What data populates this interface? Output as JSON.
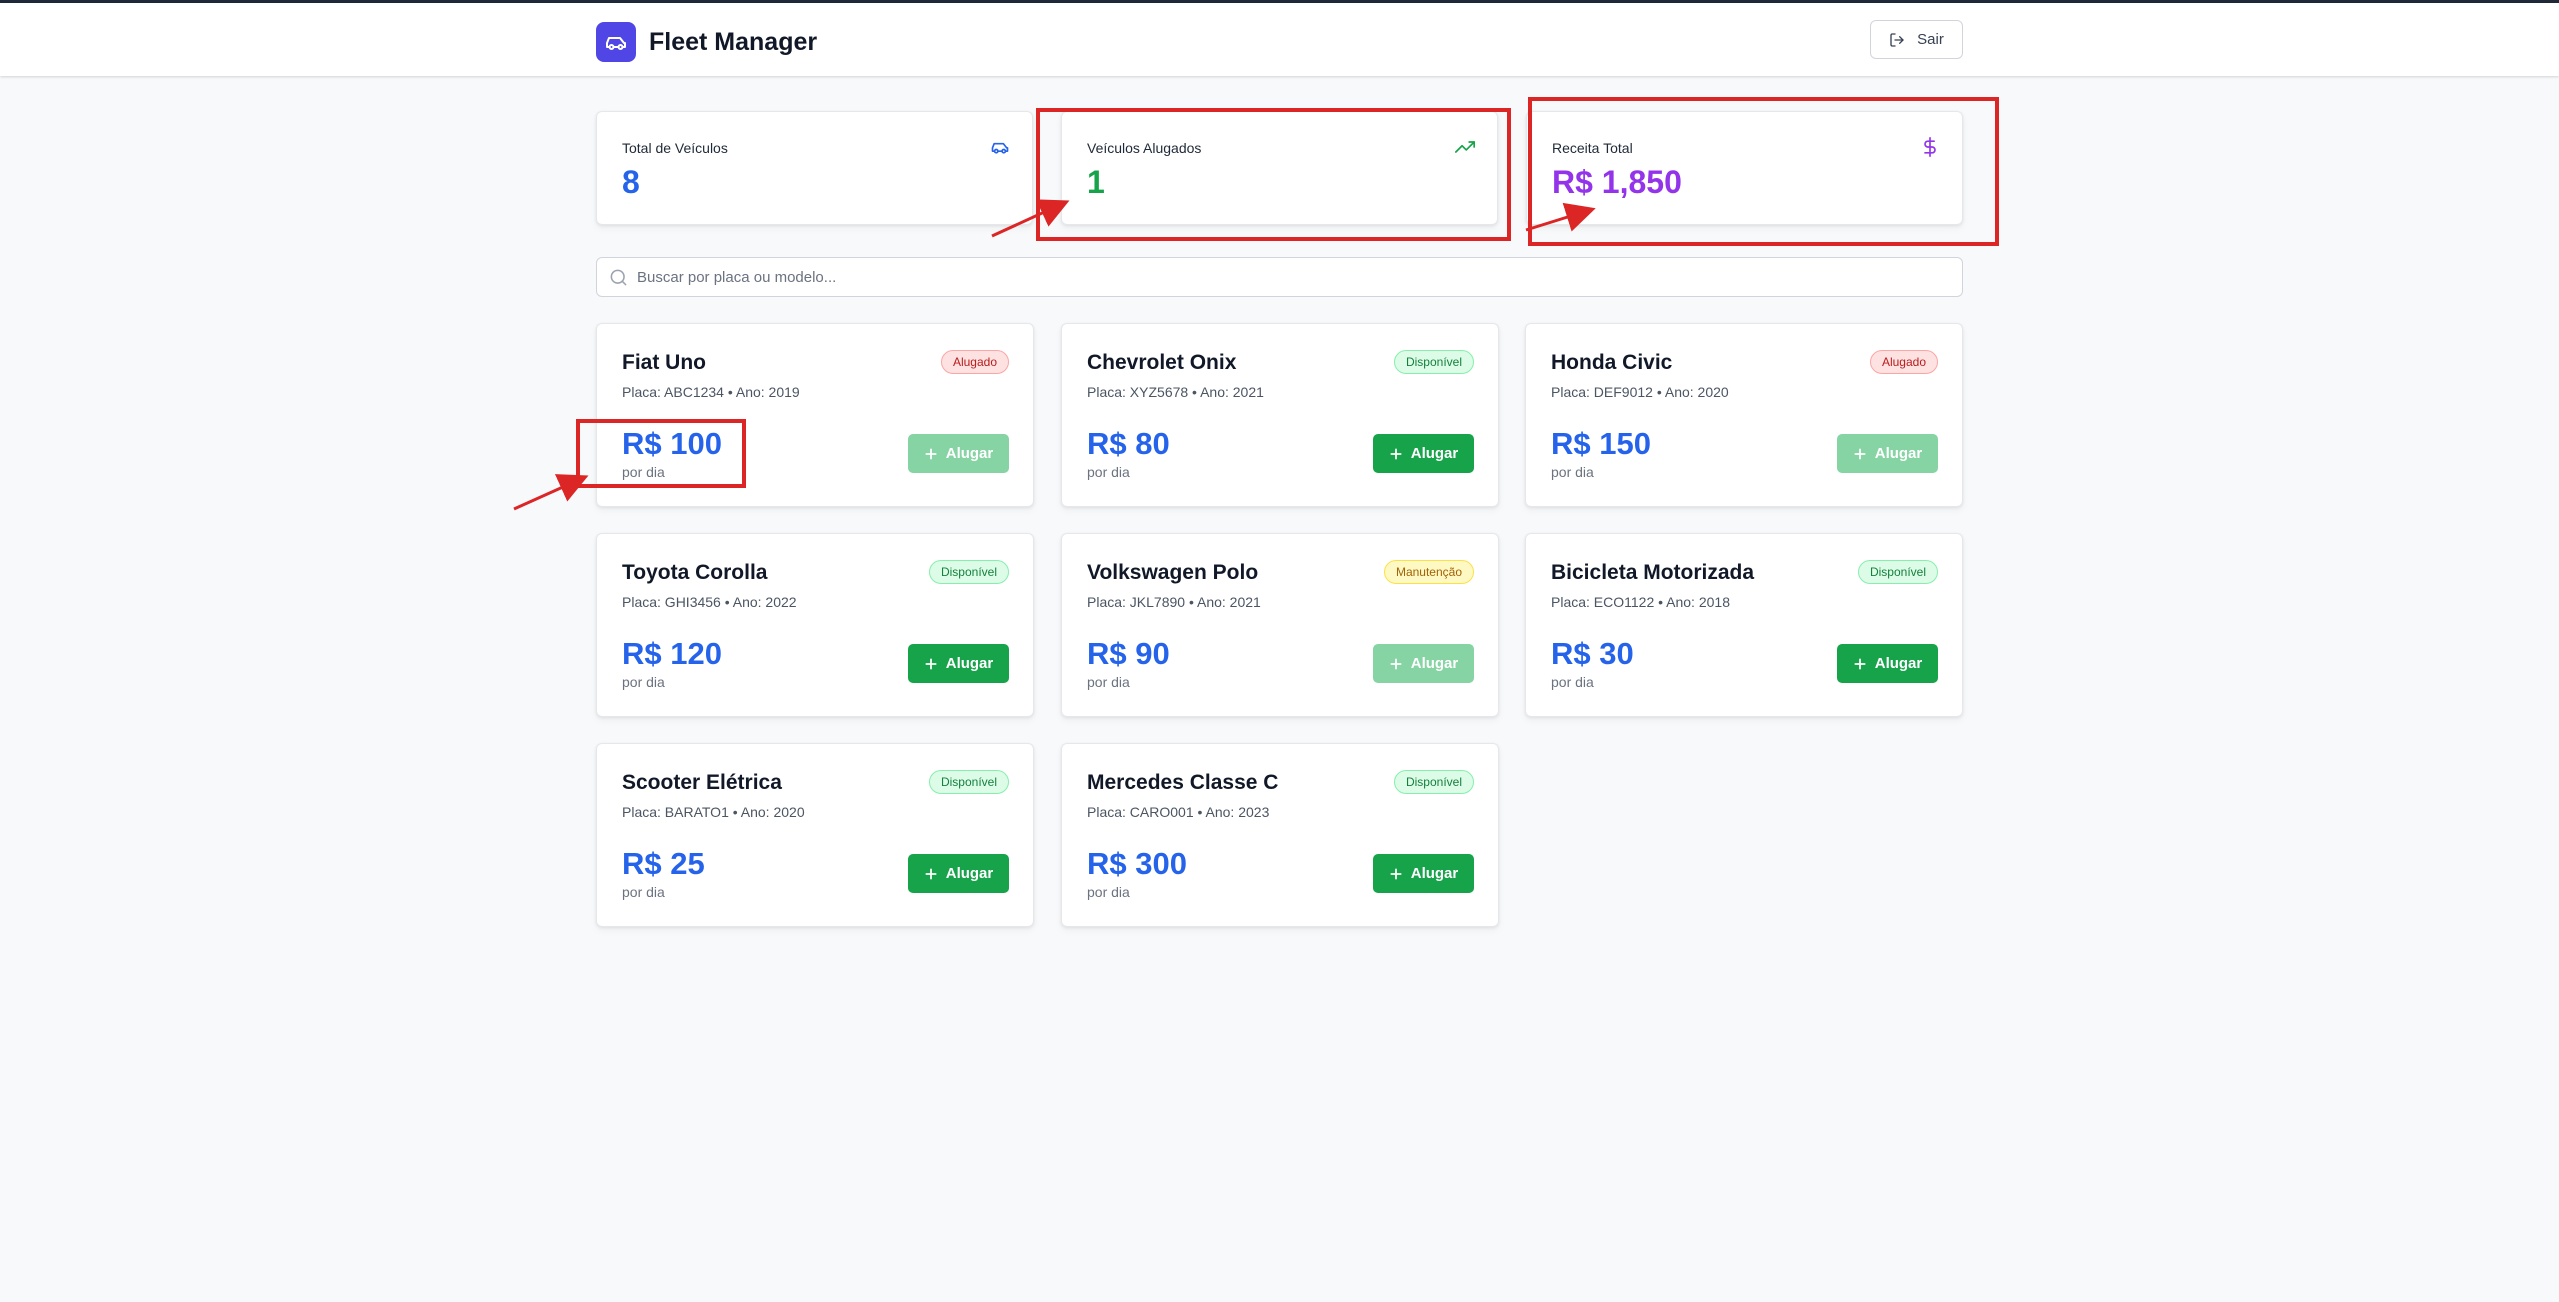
{
  "header": {
    "app_title": "Fleet Manager",
    "logout_label": "Sair"
  },
  "stats": [
    {
      "label": "Total de Veículos",
      "value": "8",
      "icon": "car-icon",
      "color": "#2563eb"
    },
    {
      "label": "Veículos Alugados",
      "value": "1",
      "icon": "trending-up-icon",
      "color": "#16a34a"
    },
    {
      "label": "Receita Total",
      "value": "R$ 1,850",
      "icon": "dollar-icon",
      "color": "#9333ea"
    }
  ],
  "search": {
    "placeholder": "Buscar por placa ou modelo...",
    "value": ""
  },
  "vehicles": [
    {
      "name": "Fiat Uno",
      "meta": "Placa: ABC1234 • Ano: 2019",
      "status": "Alugado",
      "price": "R$ 100",
      "unit": "por dia",
      "button": "Alugar"
    },
    {
      "name": "Chevrolet Onix",
      "meta": "Placa: XYZ5678 • Ano: 2021",
      "status": "Disponível",
      "price": "R$ 80",
      "unit": "por dia",
      "button": "Alugar"
    },
    {
      "name": "Honda Civic",
      "meta": "Placa: DEF9012 • Ano: 2020",
      "status": "Alugado",
      "price": "R$ 150",
      "unit": "por dia",
      "button": "Alugar"
    },
    {
      "name": "Toyota Corolla",
      "meta": "Placa: GHI3456 • Ano: 2022",
      "status": "Disponível",
      "price": "R$ 120",
      "unit": "por dia",
      "button": "Alugar"
    },
    {
      "name": "Volkswagen Polo",
      "meta": "Placa: JKL7890 • Ano: 2021",
      "status": "Manutenção",
      "price": "R$ 90",
      "unit": "por dia",
      "button": "Alugar"
    },
    {
      "name": "Bicicleta Motorizada",
      "meta": "Placa: ECO1122 • Ano: 2018",
      "status": "Disponível",
      "price": "R$ 30",
      "unit": "por dia",
      "button": "Alugar"
    },
    {
      "name": "Scooter Elétrica",
      "meta": "Placa: BARATO1 • Ano: 2020",
      "status": "Disponível",
      "price": "R$ 25",
      "unit": "por dia",
      "button": "Alugar"
    },
    {
      "name": "Mercedes Classe C",
      "meta": "Placa: CARO001 • Ano: 2023",
      "status": "Disponível",
      "price": "R$ 300",
      "unit": "por dia",
      "button": "Alugar"
    }
  ],
  "colors": {
    "brand": "#4f46e5",
    "price": "#2563eb",
    "rent_button": "#16a34a",
    "annotation": "#dc2626"
  }
}
